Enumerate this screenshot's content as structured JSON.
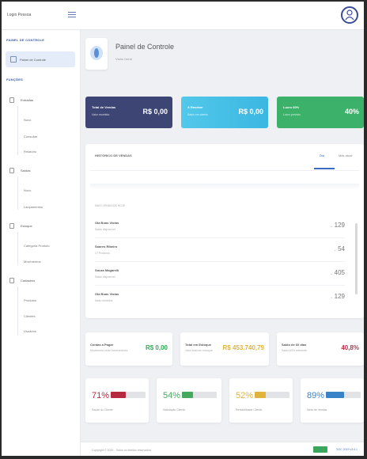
{
  "app": {
    "brand": "Login Pessoa",
    "colors": {
      "primary": "#3a4b9a",
      "sidebar_active": "#e3ecf8",
      "accent_blue": "#3a6cc4"
    }
  },
  "sidebar": {
    "section_panel": "PAINEL DE CONTROLE",
    "active_item": "Painel de Controle",
    "section_actions": "FUNÇÕES",
    "groups": [
      {
        "label": "Entradas",
        "items": [
          "Novo",
          "Consultar",
          "Relatório"
        ]
      },
      {
        "label": "Saídas",
        "items": [
          "Novo",
          "Lançamentos"
        ]
      },
      {
        "label": "Estoque",
        "items": [
          "Categoria Produto",
          "Movimentos"
        ]
      },
      {
        "label": "Cadastros",
        "items": [
          "Produtos",
          "Clientes",
          "Usuários"
        ]
      }
    ]
  },
  "page": {
    "title": "Painel de Controle",
    "subtitle": "Visão Geral"
  },
  "stats": [
    {
      "title": "Total de Vendas",
      "subtitle": "Valor recebido",
      "value": "R$ 0,00",
      "color": "#3c4573"
    },
    {
      "title": "A Receber",
      "subtitle": "Saldo em aberto",
      "value": "R$ 0,00",
      "color": "#45c2e6"
    },
    {
      "title": "Lucro 60%",
      "subtitle": "Lucro previsto",
      "value": "40%",
      "color": "#3bb169"
    }
  ],
  "history": {
    "title": "HISTÓRICO DE VENDAS",
    "tab_active": "Dia",
    "tab_inactive": "Mês atual",
    "list_header": "MAIS VENDIDOS HOJE",
    "rows": [
      {
        "name": "Ola Boas Vistas",
        "desc": "Saldo disponível",
        "count": "129"
      },
      {
        "name": "Soares Ribeiro",
        "desc": "17 Produtos",
        "count": "54"
      },
      {
        "name": "Souza Magarelli",
        "desc": "Saldo disponível",
        "count": "405"
      },
      {
        "name": "Ola Boas Vistas",
        "desc": "Mais vendidos",
        "count": "129"
      }
    ]
  },
  "summary": [
    {
      "title": "Contas a Pagar",
      "subtitle": "Movimento entre fornecedores",
      "value": "R$ 0,00",
      "color": "#3aa85c"
    },
    {
      "title": "Total em Estoque",
      "subtitle": "Valor total em estoque",
      "value": "R$ 453.740,79",
      "color": "#e0b33a"
    },
    {
      "title": "Saldo de 60 dias",
      "subtitle": "Saldo 60% referente",
      "value": "40,8%",
      "color": "#c0334d"
    }
  ],
  "percents": [
    {
      "value": "71%",
      "pct": 71,
      "label": "Saúde do Cliente",
      "color": "#b6293f"
    },
    {
      "value": "54%",
      "pct": 54,
      "label": "Satisfação Cliente",
      "color": "#45a95e"
    },
    {
      "value": "52%",
      "pct": 52,
      "label": "Rentabilidade Cliente",
      "color": "#e0b33a"
    },
    {
      "value": "89%",
      "pct": 89,
      "label": "Meta de Vendas",
      "color": "#3a82c8"
    }
  ],
  "footer": {
    "copyright": "Copyright © 2019 - Todos os direitos reservados",
    "version": "SGC 2019 v3.0.1"
  }
}
